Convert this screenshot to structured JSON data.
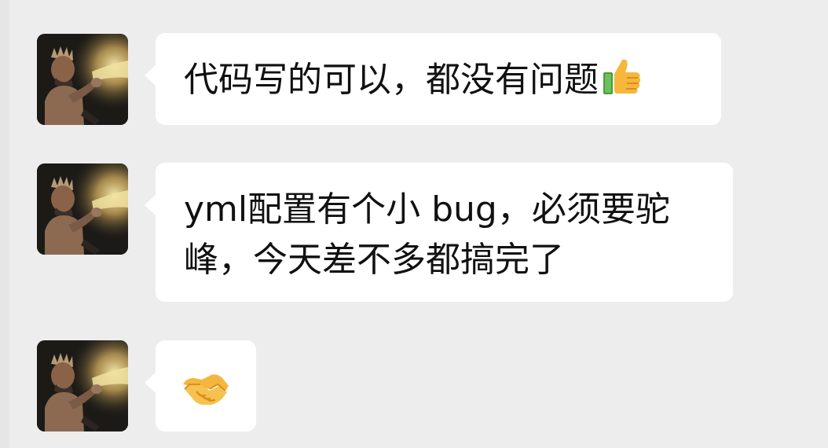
{
  "conversation": {
    "messages": [
      {
        "sender_avatar": "avatar-photo",
        "text": "代码写的可以，都没有问题",
        "trailing_emoji": "thumbs-up-icon"
      },
      {
        "sender_avatar": "avatar-photo",
        "lines": [
          "yml配置有个小 bug，必须要驼",
          "峰，今天差不多都搞完了"
        ]
      },
      {
        "sender_avatar": "avatar-photo",
        "emoji": "handshake-icon"
      }
    ]
  },
  "colors": {
    "background": "#ededed",
    "bubble": "#ffffff",
    "text": "#111111"
  }
}
